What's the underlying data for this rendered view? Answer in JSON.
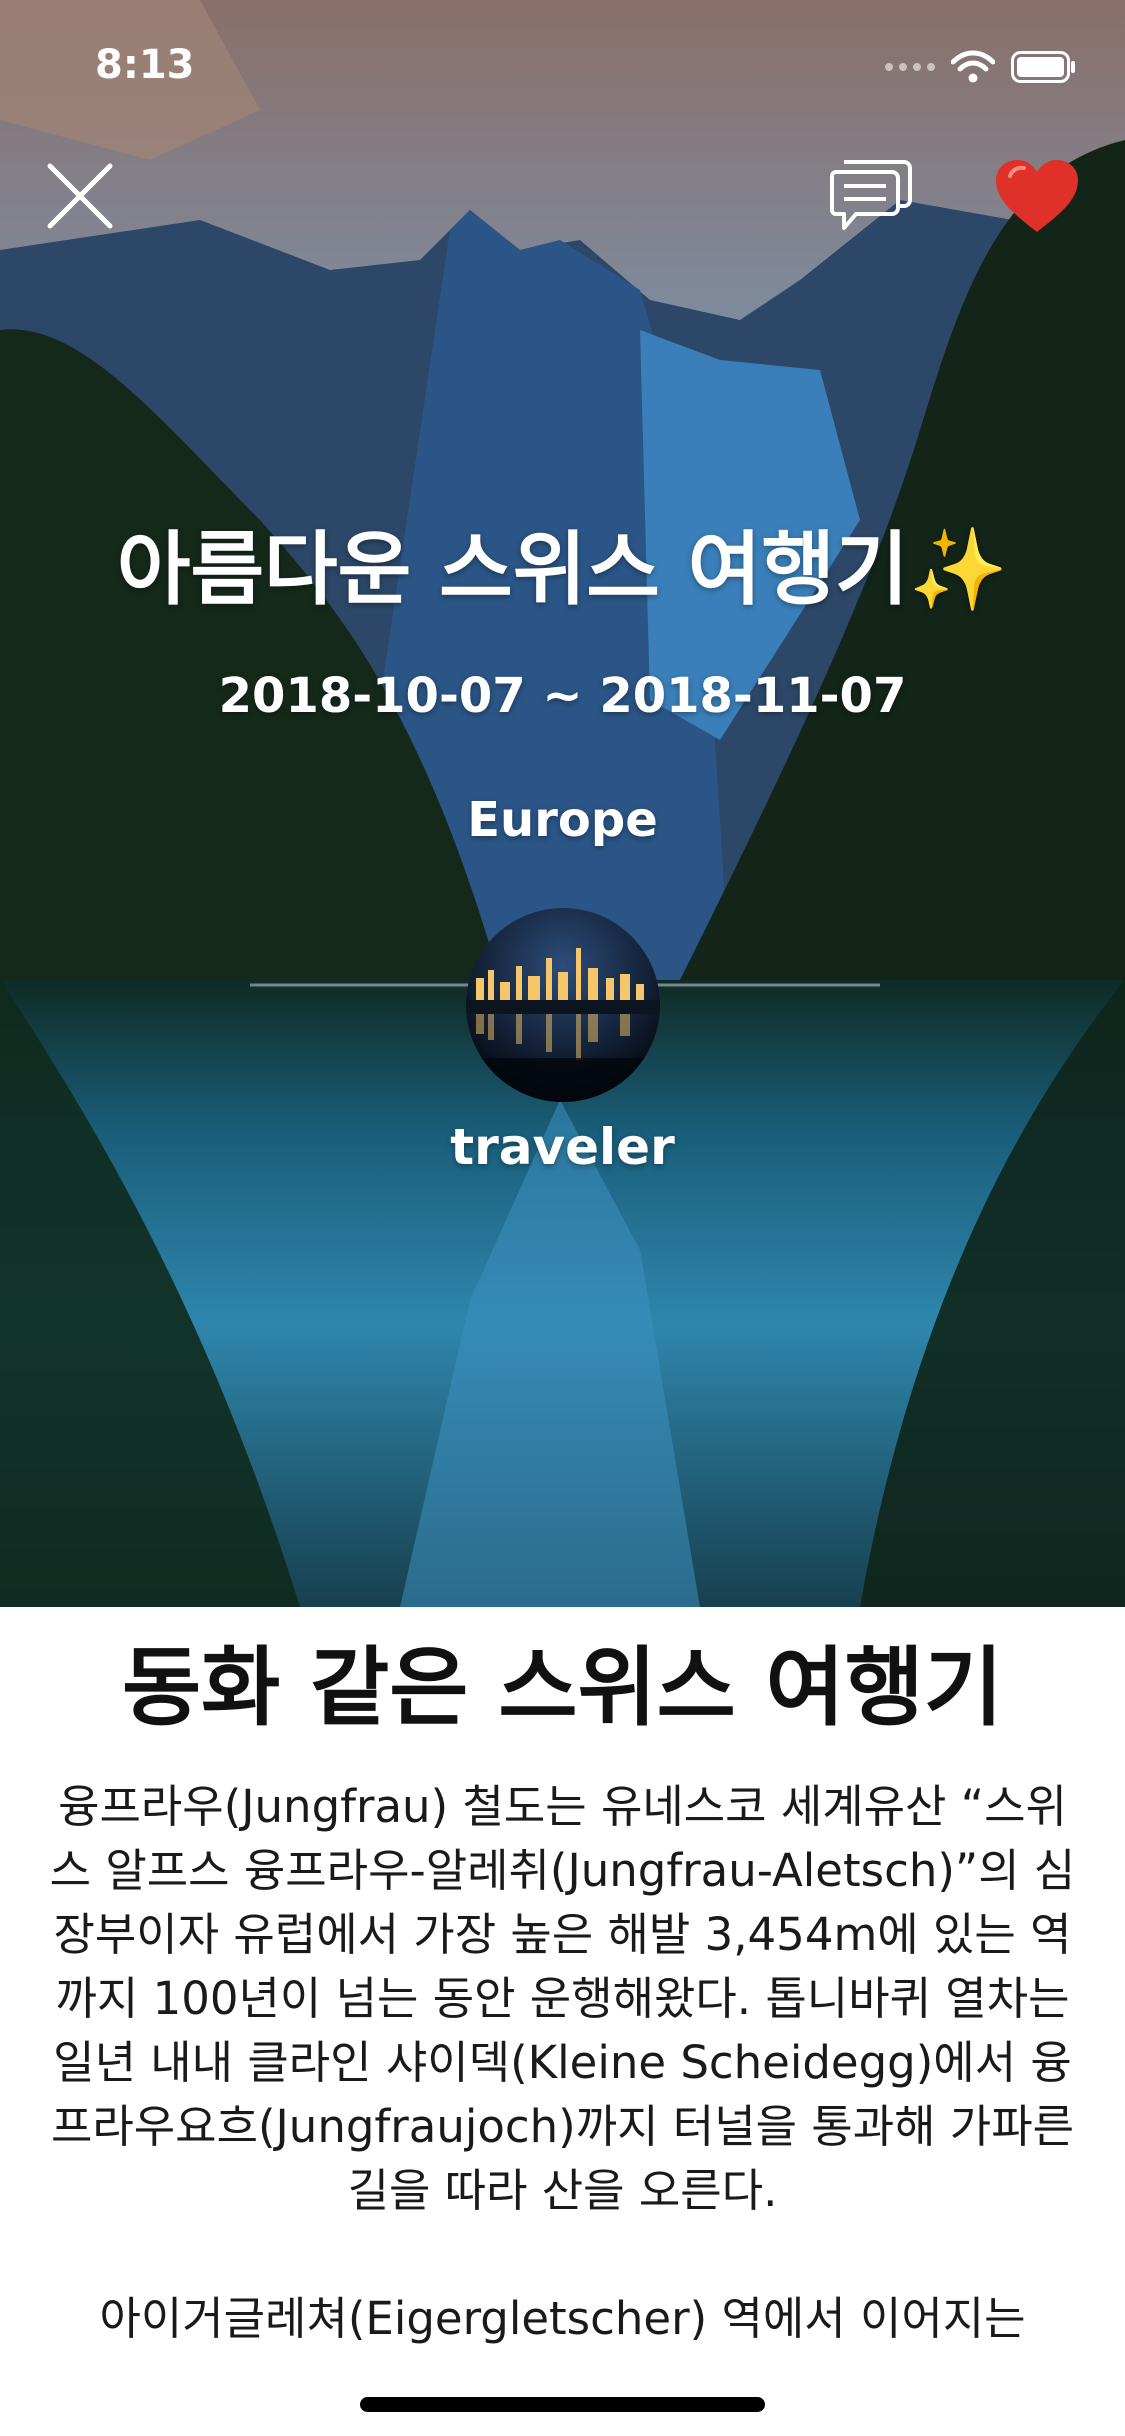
{
  "status_bar": {
    "time": "8:13",
    "icons": [
      "signal-icon",
      "wifi-icon",
      "battery-icon"
    ]
  },
  "header": {
    "icons": [
      "close-icon",
      "comment-icon",
      "heart-icon"
    ],
    "heart_color": "#e53935"
  },
  "trip": {
    "title": "아름다운 스위스 여행기✨",
    "dates": "2018-10-07 ~ 2018-11-07",
    "region": "Europe",
    "author": "traveler"
  },
  "article": {
    "title": "동화 같은 스위스 여행기",
    "paragraphs": [
      "융프라우(Jungfrau) 철도는 유네스코 세계유산 “스위스 알프스 융프라우-알레취(Jungfrau-Aletsch)”의 심장부이자 유럽에서 가장 높은 해발 3,454m에 있는 역까지 100년이 넘는 동안 운행해왔다. 톱니바퀴 열차는 일년 내내 클라인 샤이덱(Kleine Scheidegg)에서 융프라우요흐(Jungfraujoch)까지 터널을 통과해 가파른 길을 따라 산을 오른다.",
      "아이거글레쳐(Eigergletscher) 역에서 이어지는"
    ]
  }
}
